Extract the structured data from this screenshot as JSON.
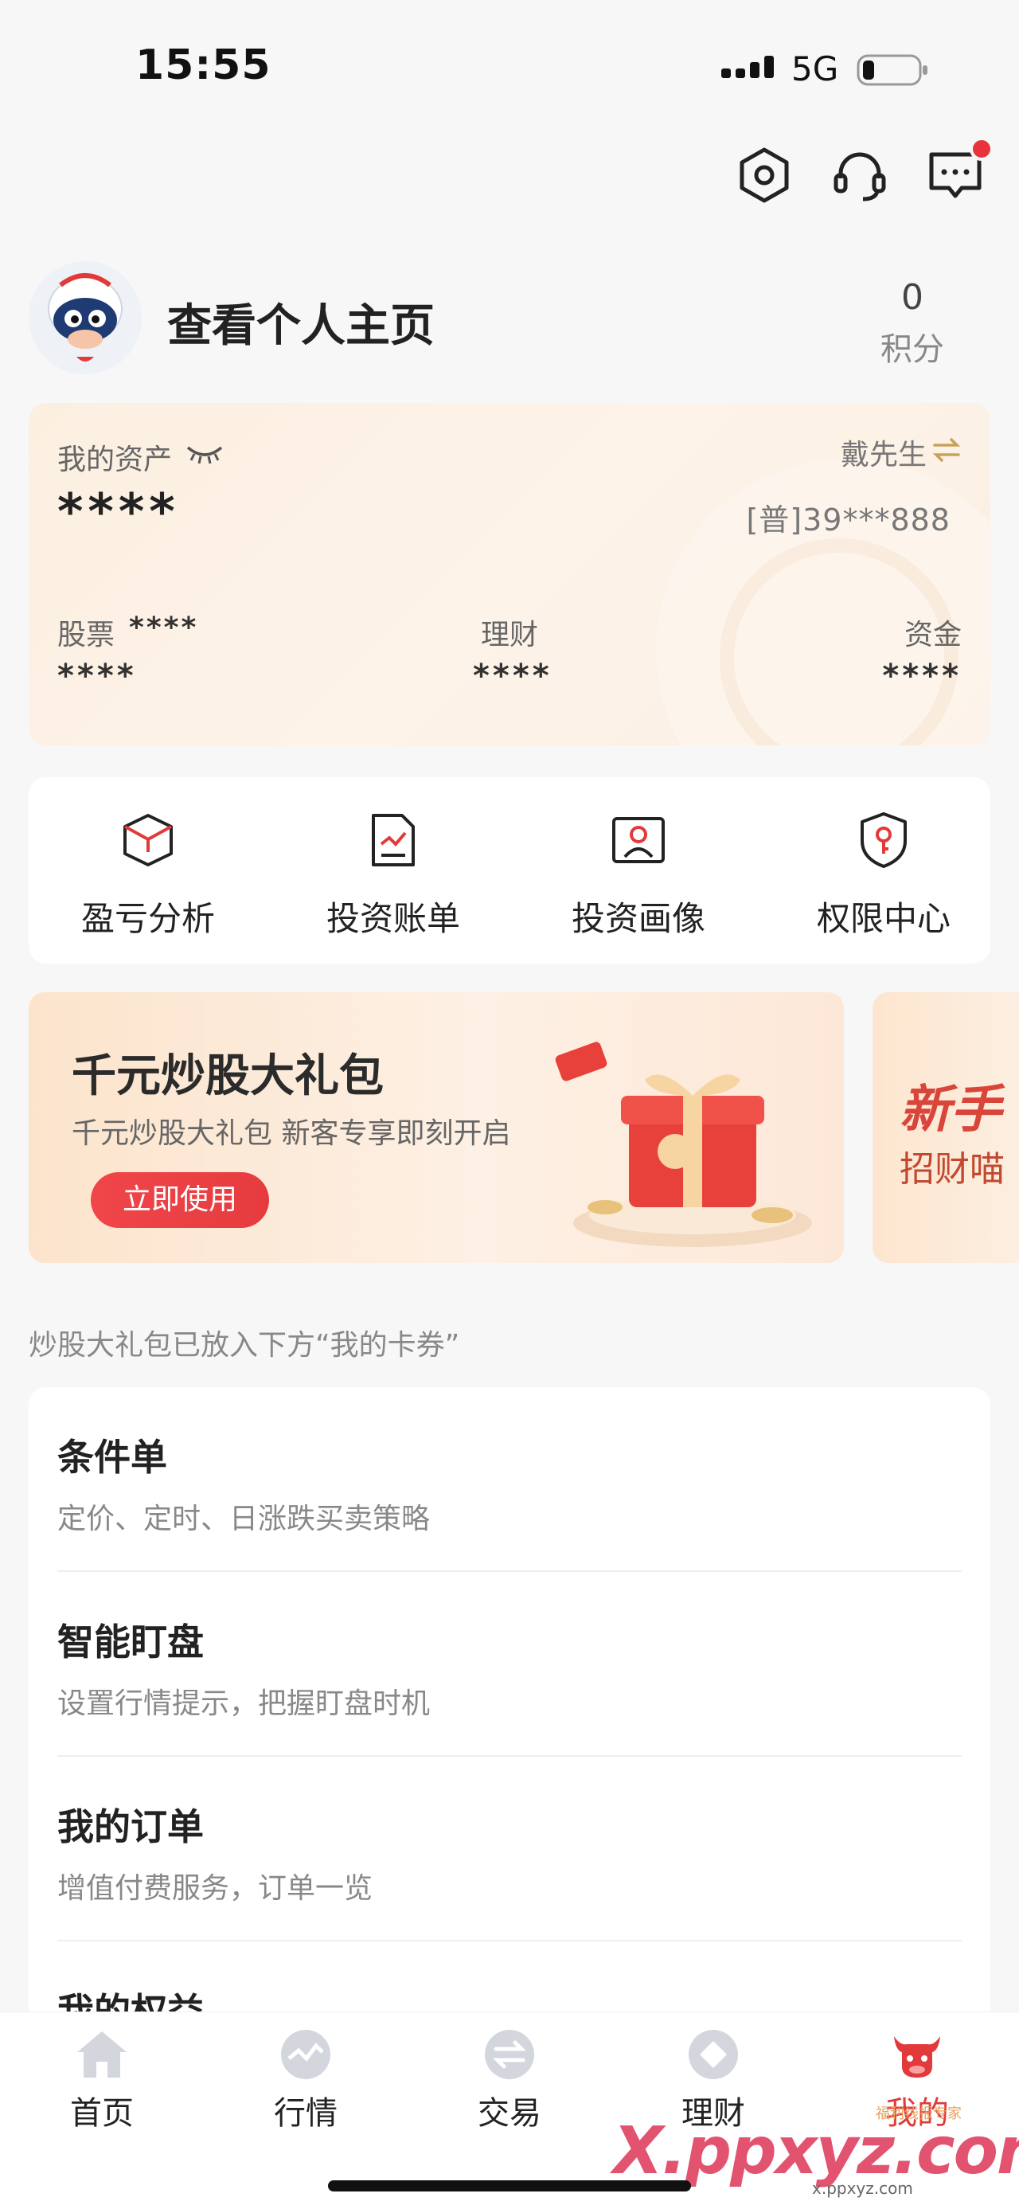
{
  "status_bar": {
    "time": "15:55",
    "network": "5G"
  },
  "header": {
    "icons": [
      "settings-icon",
      "customer-service-icon",
      "message-icon"
    ],
    "has_notification": true
  },
  "profile": {
    "link_label": "查看个人主页",
    "points_value": "0",
    "points_label": "积分"
  },
  "assets": {
    "label": "我的资产",
    "total_masked": "****",
    "account_name": "戴先生",
    "account_number": "[普]39***888",
    "stock_label": "股票",
    "stock_inline_masked": "****",
    "stock_value": "****",
    "wealth_label": "理财",
    "wealth_value": "****",
    "cash_label": "资金",
    "cash_value": "****"
  },
  "tools": [
    {
      "label": "盈亏分析",
      "icon": "cube-icon"
    },
    {
      "label": "投资账单",
      "icon": "bill-chart-icon"
    },
    {
      "label": "投资画像",
      "icon": "portrait-icon"
    },
    {
      "label": "权限中心",
      "icon": "shield-key-icon"
    }
  ],
  "banner": {
    "title": "千元炒股大礼包",
    "subtitle": "千元炒股大礼包 新客专享即刻开启",
    "button": "立即使用"
  },
  "banner2": {
    "title": "新手",
    "subtitle": "招财喵"
  },
  "hint": "炒股大礼包已放入下方“我的卡券”",
  "menu": [
    {
      "title": "条件单",
      "desc": "定价、定时、日涨跌买卖策略"
    },
    {
      "title": "智能盯盘",
      "desc": "设置行情提示，把握盯盘时机"
    },
    {
      "title": "我的订单",
      "desc": "增值付费服务，订单一览"
    },
    {
      "title": "我的权益",
      "desc": ""
    }
  ],
  "tab_bar": [
    {
      "label": "首页",
      "icon": "home-icon"
    },
    {
      "label": "行情",
      "icon": "market-icon"
    },
    {
      "label": "交易",
      "icon": "trade-icon"
    },
    {
      "label": "理财",
      "icon": "wealth-icon"
    },
    {
      "label": "我的",
      "icon": "mine-bull-icon",
      "active": true
    }
  ],
  "watermark": {
    "main": "X.ppxyz.com",
    "top": "福利线报专家",
    "sub": "x.ppxyz.com"
  },
  "colors": {
    "accent_red": "#e63b3f",
    "active_tab": "#e23a3a",
    "card_bg": "#fbefe0"
  }
}
